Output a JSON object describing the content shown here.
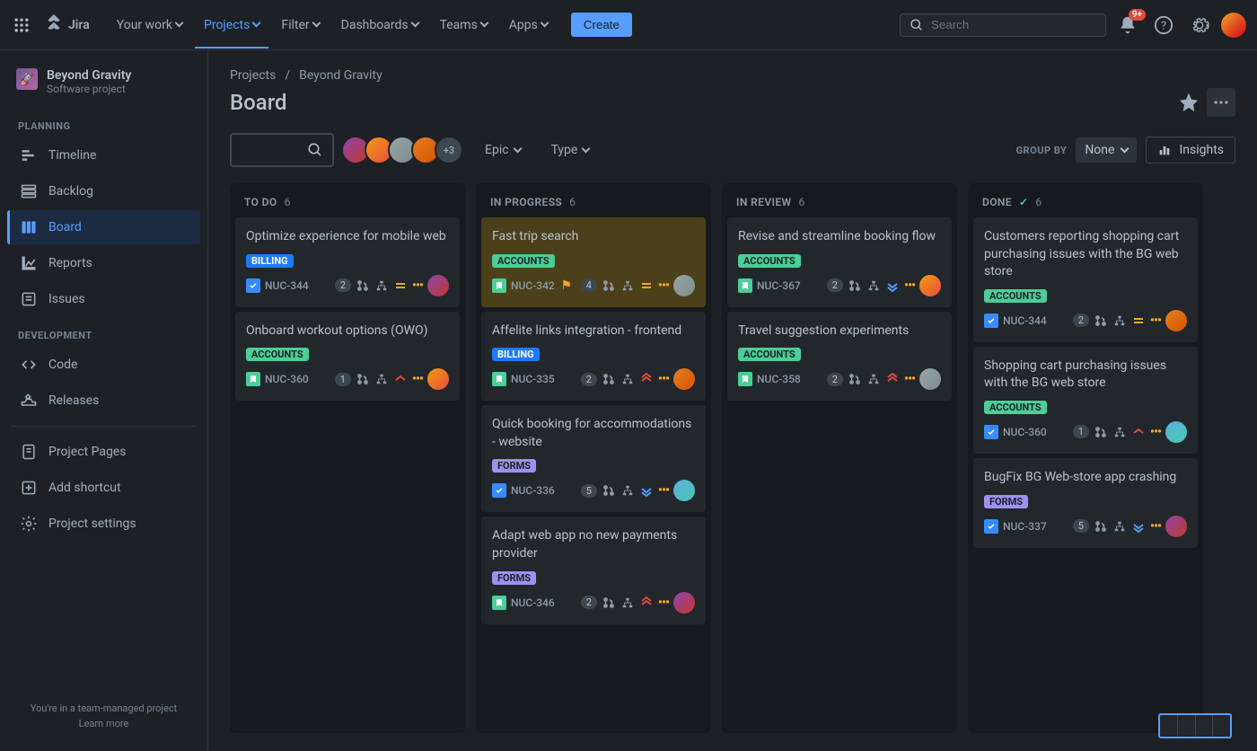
{
  "topnav": {
    "logo": "Jira",
    "items": [
      {
        "label": "Your work"
      },
      {
        "label": "Projects"
      },
      {
        "label": "Filter"
      },
      {
        "label": "Dashboards"
      },
      {
        "label": "Teams"
      },
      {
        "label": "Apps"
      }
    ],
    "create": "Create",
    "search_placeholder": "Search",
    "notif_badge": "9+"
  },
  "sidebar": {
    "project_name": "Beyond Gravity",
    "project_type": "Software project",
    "planning_label": "PLANNING",
    "development_label": "DEVELOPMENT",
    "planning": [
      {
        "label": "Timeline"
      },
      {
        "label": "Backlog"
      },
      {
        "label": "Board"
      },
      {
        "label": "Reports"
      },
      {
        "label": "Issues"
      }
    ],
    "development": [
      {
        "label": "Code"
      },
      {
        "label": "Releases"
      }
    ],
    "misc": [
      {
        "label": "Project Pages"
      },
      {
        "label": "Add shortcut"
      },
      {
        "label": "Project settings"
      }
    ],
    "footer1": "You're in a team-managed project",
    "footer2": "Learn more"
  },
  "main": {
    "crumb1": "Projects",
    "crumb2": "Beyond Gravity",
    "title": "Board",
    "avatars_more": "+3",
    "epic_label": "Epic",
    "type_label": "Type",
    "groupby_label": "GROUP BY",
    "groupby_value": "None",
    "insights": "Insights"
  },
  "columns": [
    {
      "name": "TO DO",
      "count": "6"
    },
    {
      "name": "IN PROGRESS",
      "count": "6"
    },
    {
      "name": "IN REVIEW",
      "count": "6"
    },
    {
      "name": "DONE",
      "count": "6"
    }
  ],
  "cards": {
    "c0_0": {
      "title": "Optimize experience for mobile web",
      "epic": "BILLING",
      "epic_class": "epic-billing",
      "type": "task",
      "key": "NUC-344",
      "count": "2",
      "prio": "medium"
    },
    "c0_1": {
      "title": "Onboard workout options (OWO)",
      "epic": "ACCOUNTS",
      "epic_class": "epic-accounts",
      "type": "story",
      "key": "NUC-360",
      "count": "1",
      "prio": "low-red"
    },
    "c1_0": {
      "title": "Fast trip search",
      "epic": "ACCOUNTS",
      "epic_class": "epic-accounts",
      "type": "story",
      "key": "NUC-342",
      "count": "4",
      "prio": "medium",
      "flag": true
    },
    "c1_1": {
      "title": "Affelite links integration - frontend",
      "epic": "BILLING",
      "epic_class": "epic-billing",
      "type": "story",
      "key": "NUC-335",
      "count": "2",
      "prio": "highest"
    },
    "c1_2": {
      "title": "Quick booking for accommodations - website",
      "epic": "FORMS",
      "epic_class": "epic-forms",
      "type": "task",
      "key": "NUC-336",
      "count": "5",
      "prio": "lowest"
    },
    "c1_3": {
      "title": "Adapt web app no new payments provider",
      "epic": "FORMS",
      "epic_class": "epic-forms",
      "type": "story",
      "key": "NUC-346",
      "count": "2",
      "prio": "highest"
    },
    "c2_0": {
      "title": "Revise and streamline booking flow",
      "epic": "ACCOUNTS",
      "epic_class": "epic-accounts",
      "type": "story",
      "key": "NUC-367",
      "count": "2",
      "prio": "lowest"
    },
    "c2_1": {
      "title": "Travel suggestion experiments",
      "epic": "ACCOUNTS",
      "epic_class": "epic-accounts",
      "type": "story",
      "key": "NUC-358",
      "count": "2",
      "prio": "highest"
    },
    "c3_0": {
      "title": "Customers reporting shopping cart purchasing issues with the BG web store",
      "epic": "ACCOUNTS",
      "epic_class": "epic-accounts",
      "type": "task",
      "key": "NUC-344",
      "count": "2",
      "prio": "medium"
    },
    "c3_1": {
      "title": "Shopping cart purchasing issues with the BG web store",
      "epic": "ACCOUNTS",
      "epic_class": "epic-accounts",
      "type": "task",
      "key": "NUC-360",
      "count": "1",
      "prio": "low-red"
    },
    "c3_2": {
      "title": "BugFix BG Web-store app crashing",
      "epic": "FORMS",
      "epic_class": "epic-forms",
      "type": "task",
      "key": "NUC-337",
      "count": "5",
      "prio": "lowest"
    }
  }
}
